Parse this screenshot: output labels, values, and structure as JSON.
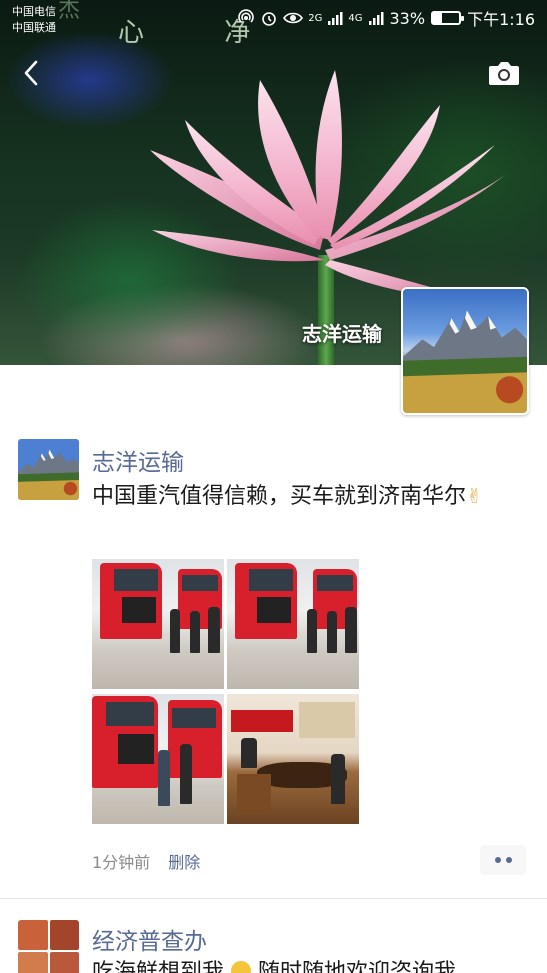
{
  "status_bar": {
    "carrier_1": "中国电信",
    "carrier_2": "中国联通",
    "network_1": "2G",
    "network_2": "4G",
    "battery_percent": "33%",
    "battery_level": 0.33,
    "time": "下午1:16",
    "icons": [
      "hotspot-icon",
      "alarm-icon",
      "eye-icon",
      "signal-icon",
      "battery-icon"
    ]
  },
  "cover": {
    "calligraphy": "心 净",
    "calligraphy_faded": "杰",
    "owner_name": "志洋运输"
  },
  "posts": [
    {
      "author": "志洋运输",
      "text": "中国重汽值得信赖，买车就到济南华尔",
      "emoji": "✌",
      "time_ago": "1分钟前",
      "delete_label": "删除",
      "photos": [
        "truck-photo",
        "truck-photo",
        "truck-photo",
        "meeting-photo"
      ]
    },
    {
      "author": "经济普查办",
      "text": "吃海鲜想到我",
      "text_after_emoji": "随时随地欢迎咨询我"
    }
  ],
  "colors": {
    "name_link": "#576b95",
    "body_text": "#1a1a1a",
    "meta_text": "#8a8a8a",
    "truck_red": "#d8202c"
  }
}
